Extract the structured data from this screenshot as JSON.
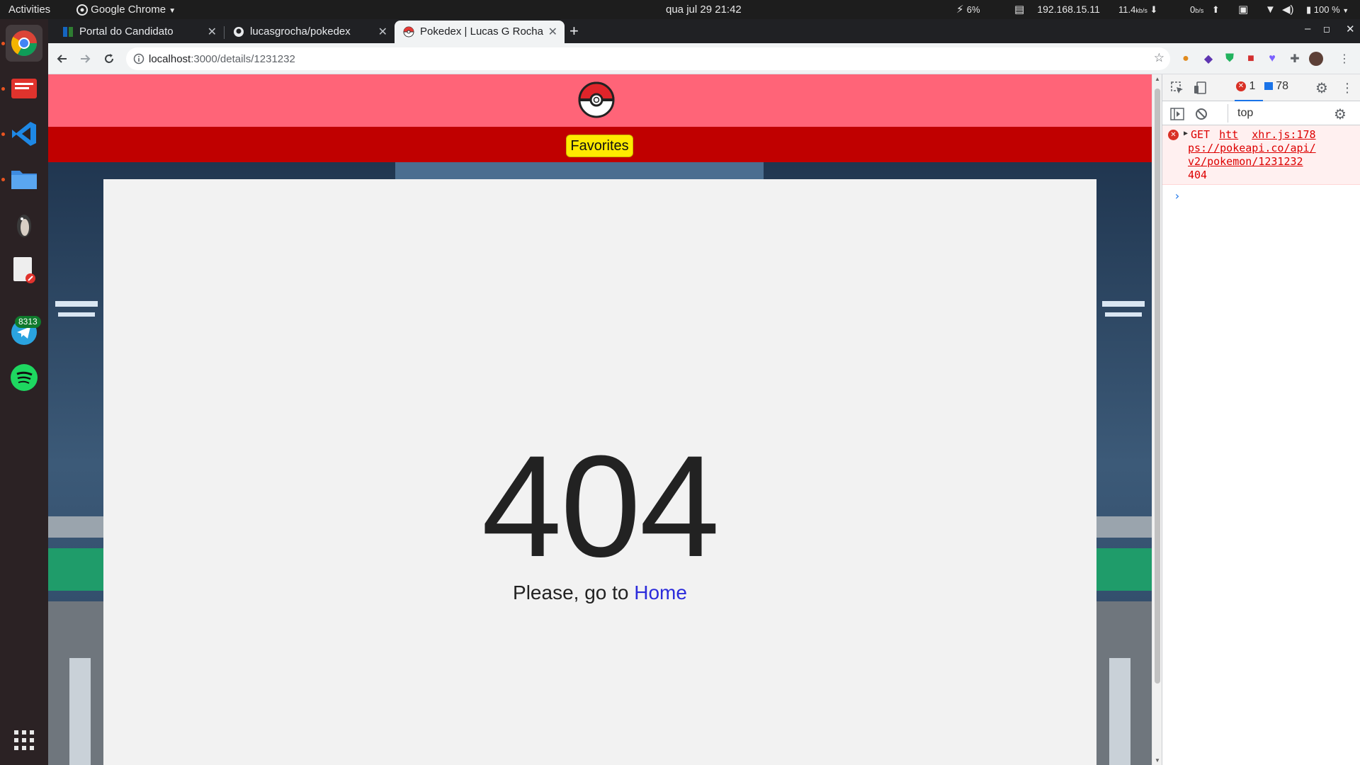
{
  "topbar": {
    "activities": "Activities",
    "app_name": "Google Chrome",
    "datetime": "qua jul 29  21:42",
    "cpu": "6%",
    "ip": "192.168.15.11",
    "net_down": "11.4",
    "net_down_unit": "kb/s",
    "net_up": "0",
    "net_up_unit": "b/s",
    "battery": "100 %"
  },
  "dock": {
    "telegram_badge": "8313",
    "icons": [
      "chrome-icon",
      "screenshot-tool-icon",
      "vscode-icon",
      "files-icon",
      "inkscape-icon",
      "text-editor-icon",
      "telegram-icon",
      "spotify-icon",
      "app-grid-icon"
    ]
  },
  "tabs": [
    {
      "title": "Portal do Candidato",
      "favicon": "portal-favicon-icon"
    },
    {
      "title": "lucasgrocha/pokedex",
      "favicon": "github-favicon-icon"
    },
    {
      "title": "Pokedex | Lucas G Rocha",
      "favicon": "pokeball-favicon-icon",
      "active": true
    }
  ],
  "address": {
    "host": "localhost",
    "rest": ":3000/details/1231232"
  },
  "page": {
    "favorites_label": "Favorites",
    "error_code": "404",
    "message_prefix": "Please, go to ",
    "home_link": "Home"
  },
  "devtools": {
    "error_count": "1",
    "message_count": "78",
    "context": "top",
    "log": {
      "method": "GET",
      "url_part1": "htt",
      "source": "xhr.js:178",
      "url_rest_1": "ps://pokeapi.co/api/",
      "url_rest_2": "v2/pokemon/1231232",
      "status": "404"
    }
  },
  "colors": {
    "header_pink": "#ff6478",
    "header_red": "#c00000",
    "favorites_yellow": "#ffea00",
    "link_blue": "#2b2bdb",
    "devtools_error": "#dd0000"
  }
}
